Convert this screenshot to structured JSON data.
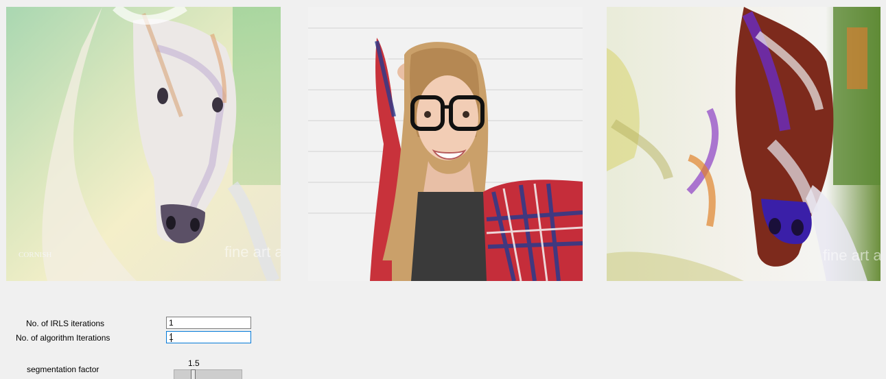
{
  "images": {
    "style_watermark": "fine art america",
    "signature": "CORNISH",
    "result_watermark": "fine art america"
  },
  "controls": {
    "irls_label": "No. of IRLS iterations",
    "irls_value": "1",
    "algo_label": "No. of algorithm Iterations",
    "algo_value": "1",
    "segmentation_label": "segmentation factor",
    "segmentation_value_text": "1.5",
    "segmentation_fraction": 0.27
  },
  "colors": {
    "window_bg": "#f0f0f0",
    "focus_border": "#0078d7"
  }
}
